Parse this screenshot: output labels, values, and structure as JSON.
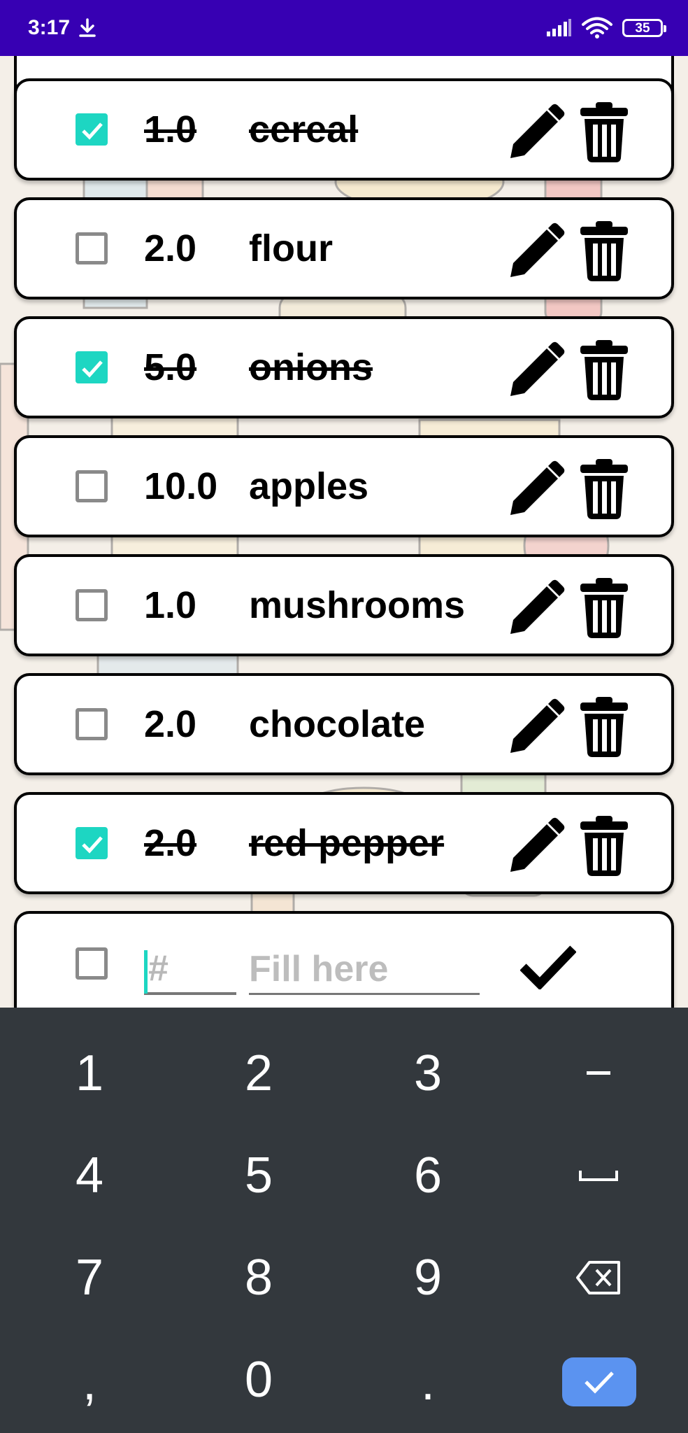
{
  "status_bar": {
    "time": "3:17",
    "battery": "35",
    "icons": [
      "download-icon",
      "signal-icon",
      "wifi-icon",
      "battery-icon"
    ]
  },
  "items": [
    {
      "quantity": "1.0",
      "name": "cereal",
      "checked": true
    },
    {
      "quantity": "2.0",
      "name": "flour",
      "checked": false
    },
    {
      "quantity": "5.0",
      "name": "onions",
      "checked": true
    },
    {
      "quantity": "10.0",
      "name": "apples",
      "checked": false
    },
    {
      "quantity": "1.0",
      "name": "mushrooms",
      "checked": false
    },
    {
      "quantity": "2.0",
      "name": "chocolate",
      "checked": false
    },
    {
      "quantity": "2.0",
      "name": "red pepper",
      "checked": true
    }
  ],
  "new_item": {
    "quantity_placeholder": "#",
    "name_placeholder": "Fill here",
    "quantity_value": "",
    "name_value": ""
  },
  "keyboard": {
    "rows": [
      [
        "1",
        "2",
        "3",
        "–"
      ],
      [
        "4",
        "5",
        "6",
        "␣"
      ],
      [
        "7",
        "8",
        "9",
        "⌫"
      ],
      [
        ",",
        "0",
        ".",
        "✓"
      ]
    ]
  },
  "colors": {
    "status_bar": "#3700b3",
    "checkbox_checked": "#1dd6c2",
    "keyboard_bg": "#33383d",
    "done_key": "#5b93f0"
  }
}
